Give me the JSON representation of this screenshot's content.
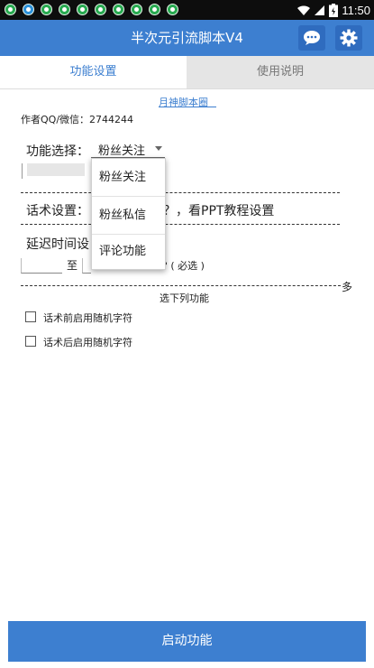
{
  "status_bar": {
    "time": "11:50",
    "left_icons": [
      "app-notification-icon",
      "app-notification-icon",
      "app-notification-icon",
      "app-notification-icon",
      "app-notification-icon",
      "app-notification-icon",
      "app-notification-icon",
      "app-notification-icon",
      "app-notification-icon",
      "app-notification-icon"
    ],
    "right_icons": [
      "wifi-icon",
      "signal-icon",
      "battery-icon"
    ]
  },
  "app_bar": {
    "title": "半次元引流脚本V4",
    "buttons": [
      "chat-icon",
      "gear-icon"
    ]
  },
  "tabs": [
    {
      "label": "功能设置",
      "active": true
    },
    {
      "label": "使用说明",
      "active": false
    }
  ],
  "content": {
    "link_text": "月神脚本圈",
    "author_line": "作者QQ/微信：2744244",
    "feature_select": {
      "label": "功能选择：",
      "selected": "粉丝关注"
    },
    "script_row": {
      "label": "话术设置：",
      "text_tail": "？，看PPT教程设置"
    },
    "delay": {
      "label_head": "延迟时间设",
      "to_char": "至",
      "unit_hint": "? ( 必选 )"
    },
    "more_char": "多",
    "select_below_hint": "选下列功能",
    "checkboxes": [
      {
        "label": "话术前启用随机字符",
        "checked": false
      },
      {
        "label": "话术后启用随机字符",
        "checked": false
      }
    ]
  },
  "dropdown": {
    "open": true,
    "options": [
      "粉丝关注",
      "粉丝私信",
      "评论功能"
    ]
  },
  "start_button": {
    "label": "启动功能"
  },
  "colors": {
    "primary": "#3d7fd0",
    "tab_inactive_bg": "#e5e5e5",
    "status_bar": "#0d0d0d",
    "notification_icon": "#27a94f"
  }
}
